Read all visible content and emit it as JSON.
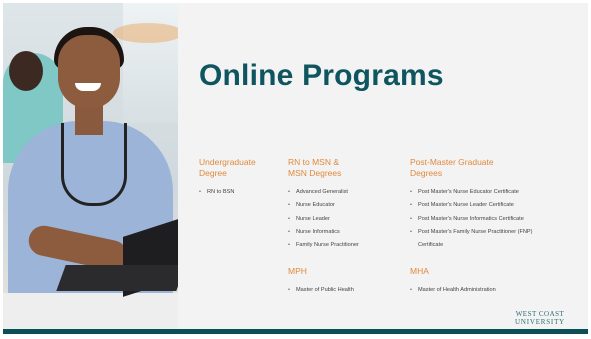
{
  "title": "Online Programs",
  "columns": [
    {
      "heading_line1": "Undergraduate",
      "heading_line2": "Degree",
      "items": [
        "RN to BSN"
      ]
    },
    {
      "heading_line1": "RN to MSN &",
      "heading_line2": "MSN Degrees",
      "items": [
        "Advanced Generalist",
        "Nurse Educator",
        "Nurse Leader",
        "Nurse Informatics",
        "Family Nurse Practitioner"
      ]
    },
    {
      "heading_line1": "Post-Master Graduate",
      "heading_line2": "Degrees",
      "items": [
        "Post Master's Nurse Educator Certificate",
        "Post Master's Nurse Leader Certificate",
        "Post Master's Nurse Informatics Certificate",
        "Post Master's Family Nurse Practitioner (FNP) Certificate"
      ]
    },
    {
      "heading_line1": "MPH",
      "items": [
        "Master of Public Health"
      ]
    },
    {
      "heading_line1": "MHA",
      "items": [
        "Master of Health Administration"
      ]
    }
  ],
  "logo": {
    "line1": "WEST COAST",
    "line2": "UNIVERSITY"
  },
  "colors": {
    "title": "#0e5560",
    "heading": "#e0893c",
    "bar": "#0b4f57",
    "background": "#f3f3f3"
  }
}
